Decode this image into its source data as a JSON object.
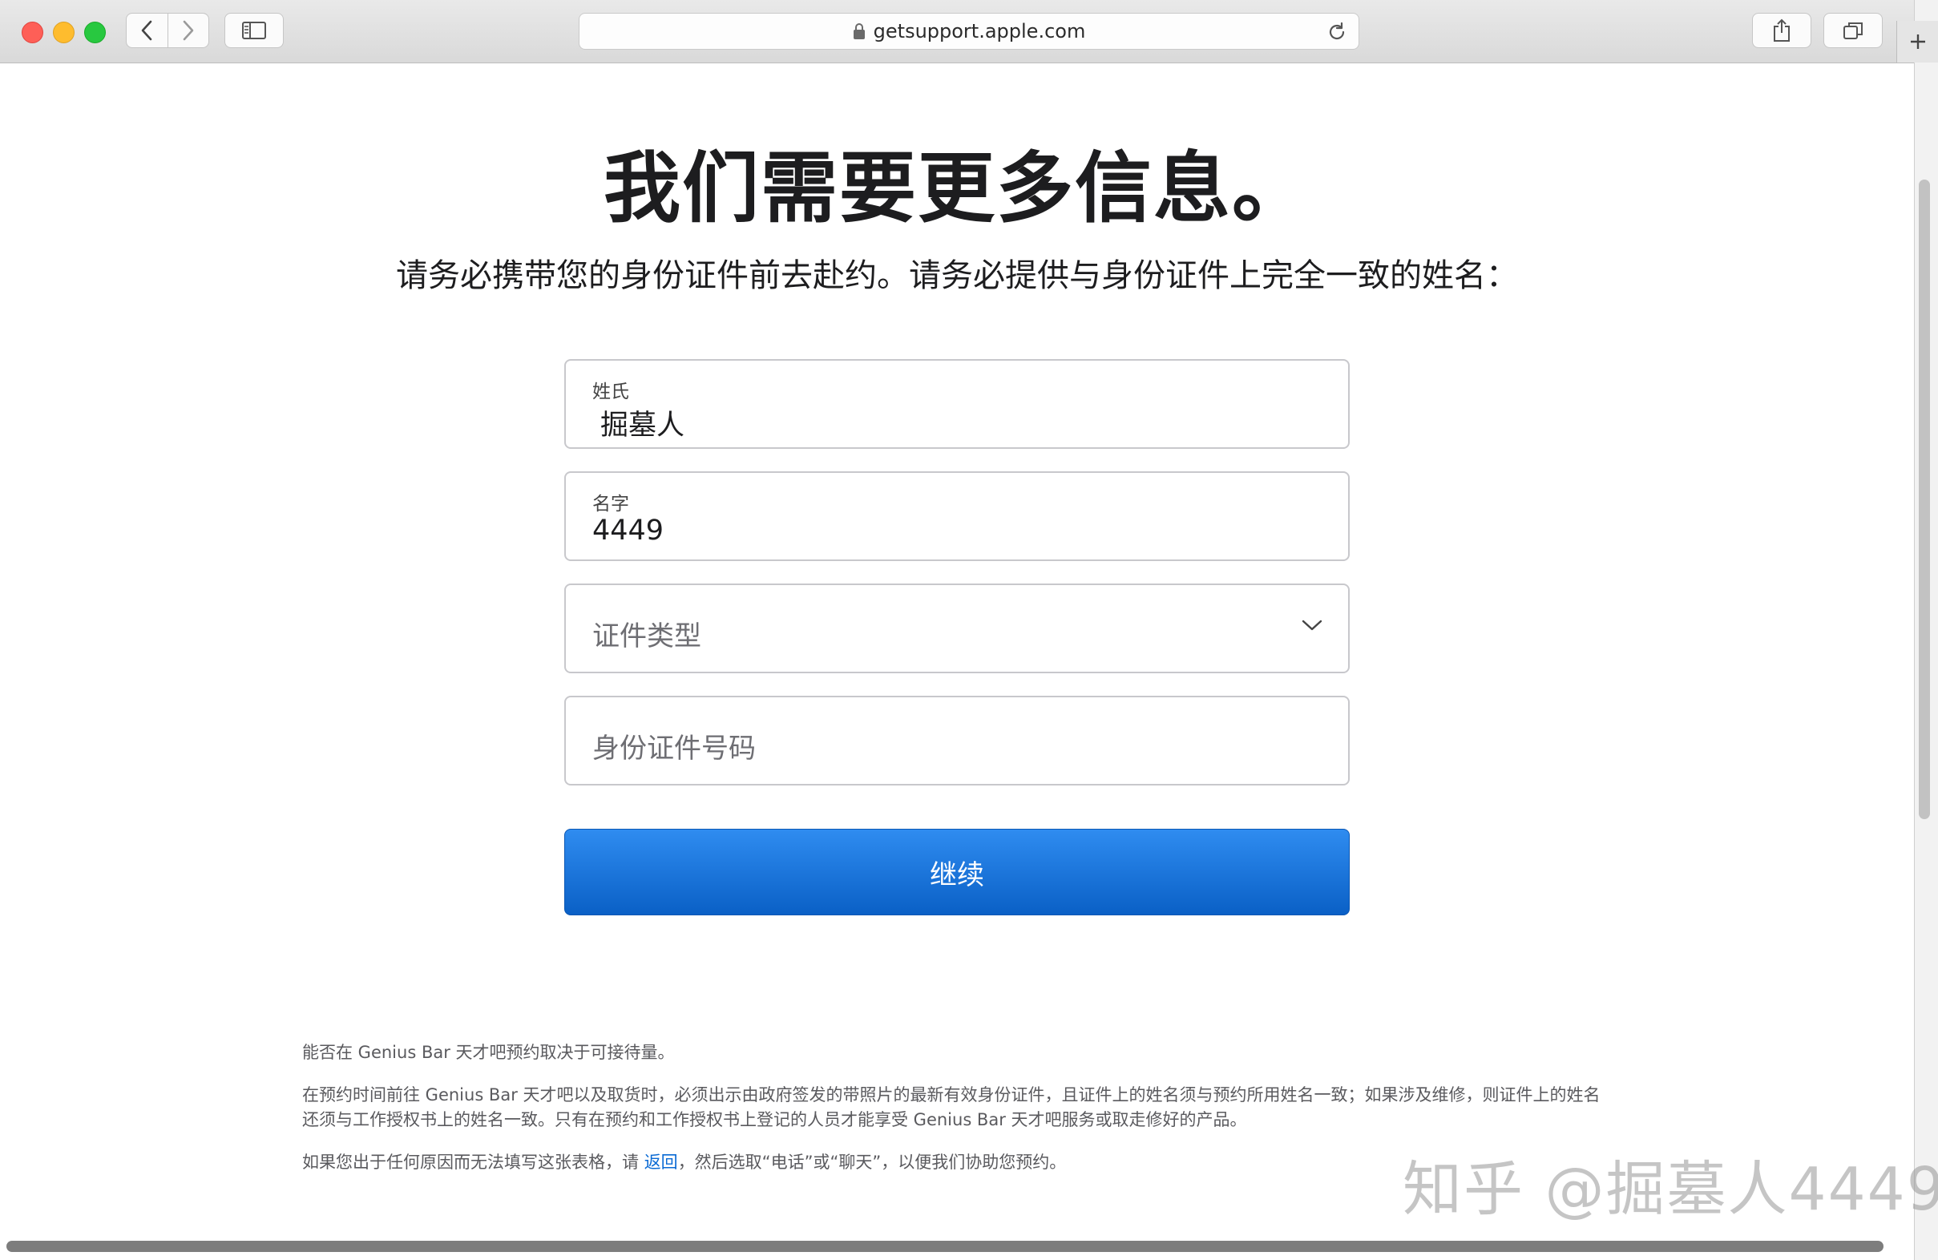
{
  "browser": {
    "url": "getsupport.apple.com"
  },
  "page": {
    "title": "我们需要更多信息。",
    "subtitle": "请务必携带您的身份证件前去赴约。请务必提供与身份证件上完全一致的姓名："
  },
  "form": {
    "surname": {
      "label": "姓氏",
      "value": "掘墓人"
    },
    "given_name": {
      "label": "名字",
      "value": "4449"
    },
    "id_type": {
      "placeholder": "证件类型"
    },
    "id_number": {
      "placeholder": "身份证件号码"
    },
    "submit_label": "继续"
  },
  "footer": {
    "note1": "能否在 Genius Bar 天才吧预约取决于可接待量。",
    "note2": "在预约时间前往 Genius Bar 天才吧以及取货时，必须出示由政府签发的带照片的最新有效身份证件，且证件上的姓名须与预约所用姓名一致；如果涉及维修，则证件上的姓名还须与工作授权书上的姓名一致。只有在预约和工作授权书上登记的人员才能享受 Genius Bar 天才吧服务或取走修好的产品。",
    "note3_before": "如果您出于任何原因而无法填写这张表格，请 ",
    "note3_link": "返回",
    "note3_after": "，然后选取“电话”或“聊天”，以便我们协助您预约。"
  },
  "watermark": "知乎 @掘墓人4449",
  "colors": {
    "accent": "#0a60c6",
    "link": "#0a6ad4"
  }
}
